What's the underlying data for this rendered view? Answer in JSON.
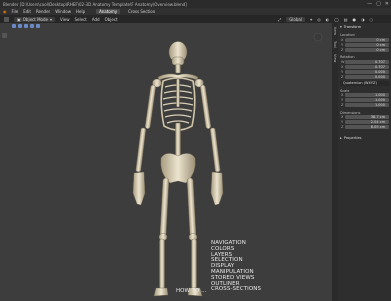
{
  "titlebar": {
    "title": "Blender [D:\\Users\\cool\\Desktop\\RHEF\\02-3D Anatomy Template\\F Anatomy\\Overview.blend]",
    "min": "—",
    "max": "▢",
    "close": "✕"
  },
  "menubar": {
    "items": [
      "File",
      "Edit",
      "Render",
      "Window",
      "Help"
    ],
    "tabs": [
      "Anatomy",
      "Cross Section"
    ],
    "active_tab": "Anatomy"
  },
  "header": {
    "mode": "Object Mode",
    "menus": [
      "View",
      "Select",
      "Add",
      "Object"
    ],
    "pivot": "Global",
    "overlays_label": "Overlays"
  },
  "viewport": {
    "menu_items": [
      "NAVIGATION",
      "COLORS",
      "LAYERS",
      "SELECTION",
      "DISPLAY",
      "MANIPULATION",
      "STORED VIEWS",
      "OUTLINER",
      "CROSS-SECTIONS"
    ],
    "howto": "HOW TO ..."
  },
  "side_tabs": [
    "Item",
    "Tool",
    "View"
  ],
  "npanel": {
    "transform_title": "Transform",
    "location_label": "Location",
    "location": [
      {
        "ax": "X",
        "val": "0 cm"
      },
      {
        "ax": "Y",
        "val": "0 cm"
      },
      {
        "ax": "Z",
        "val": "0 cm"
      }
    ],
    "rotation_label": "Rotation",
    "rotation": [
      {
        "ax": "W",
        "val": "0.707"
      },
      {
        "ax": "X",
        "val": "0.707"
      },
      {
        "ax": "Y",
        "val": "0.000"
      },
      {
        "ax": "Z",
        "val": "0.000"
      }
    ],
    "rotation_mode": "Quaternion (WXYZ)",
    "scale_label": "Scale",
    "scale": [
      {
        "ax": "X",
        "val": "1.000"
      },
      {
        "ax": "Y",
        "val": "1.000"
      },
      {
        "ax": "Z",
        "val": "1.000"
      }
    ],
    "dimensions_label": "Dimensions",
    "dimensions": [
      {
        "ax": "X",
        "val": "38.7 cm"
      },
      {
        "ax": "Y",
        "val": "2.04 cm"
      },
      {
        "ax": "Z",
        "val": "8.05 cm"
      }
    ],
    "properties_title": "Properties"
  },
  "colors": {
    "bone": "#e4dcc6",
    "bone_shadow": "#a89c80",
    "viewport_bg": "#3d3d3d"
  }
}
